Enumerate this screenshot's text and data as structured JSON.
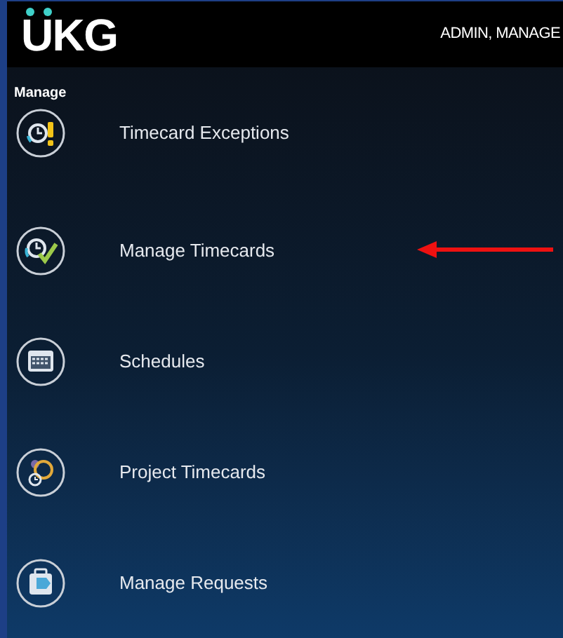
{
  "header": {
    "logo": "UKG",
    "user": "ADMIN, MANAGE"
  },
  "section": {
    "title": "Manage"
  },
  "items": [
    {
      "label": "Timecard Exceptions",
      "kind": "exceptions",
      "pointed": false
    },
    {
      "label": "Manage Timecards",
      "kind": "timecards",
      "pointed": true
    },
    {
      "label": "Schedules",
      "kind": "schedules",
      "pointed": false
    },
    {
      "label": "Project Timecards",
      "kind": "project",
      "pointed": false
    },
    {
      "label": "Manage Requests",
      "kind": "requests",
      "pointed": false
    }
  ]
}
